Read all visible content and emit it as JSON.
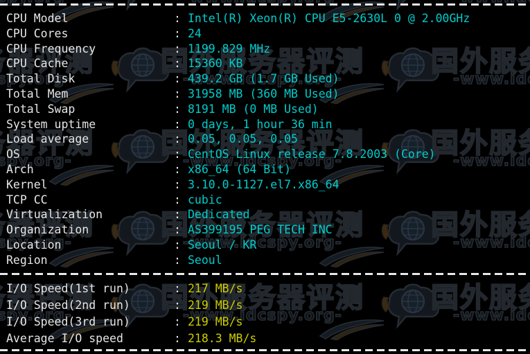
{
  "terminal": {
    "separator_char": "-",
    "colon": ":",
    "background_color": "#000000",
    "label_color": "#e6e6e6",
    "value_color_cyan": "#00cdcd",
    "value_color_yellow": "#cdcd00"
  },
  "watermark": {
    "cn_text": "国外服务器评测",
    "url_text": "-www.idcspy.org-",
    "logo_icon": "globe-speech-bubble-icon"
  },
  "system_info": [
    {
      "label": "CPU Model",
      "value": "Intel(R) Xeon(R) CPU E5-2630L 0 @ 2.00GHz"
    },
    {
      "label": "CPU Cores",
      "value": "24"
    },
    {
      "label": "CPU Frequency",
      "value": "1199.829 MHz"
    },
    {
      "label": "CPU Cache",
      "value": "15360 KB"
    },
    {
      "label": "Total Disk",
      "value": "439.2 GB (1.7 GB Used)"
    },
    {
      "label": "Total Mem",
      "value": "31958 MB (360 MB Used)"
    },
    {
      "label": "Total Swap",
      "value": "8191 MB (0 MB Used)"
    },
    {
      "label": "System uptime",
      "value": "0 days, 1 hour 36 min"
    },
    {
      "label": "Load average",
      "value": "0.05, 0.05, 0.05"
    },
    {
      "label": "OS",
      "value": "CentOS Linux release 7.8.2003 (Core)"
    },
    {
      "label": "Arch",
      "value": "x86_64 (64 Bit)"
    },
    {
      "label": "Kernel",
      "value": "3.10.0-1127.el7.x86_64"
    },
    {
      "label": "TCP CC",
      "value": "cubic"
    },
    {
      "label": "Virtualization",
      "value": "Dedicated"
    },
    {
      "label": "Organization",
      "value": "AS399195 PEG TECH INC"
    },
    {
      "label": "Location",
      "value": "Seoul / KR"
    },
    {
      "label": "Region",
      "value": "Seoul"
    }
  ],
  "io_results": [
    {
      "label": "I/O Speed(1st run)",
      "value": "217 MB/s"
    },
    {
      "label": "I/O Speed(2nd run)",
      "value": "219 MB/s"
    },
    {
      "label": "I/O Speed(3rd run)",
      "value": "219 MB/s"
    },
    {
      "label": "Average I/O speed",
      "value": "218.3 MB/s"
    }
  ]
}
